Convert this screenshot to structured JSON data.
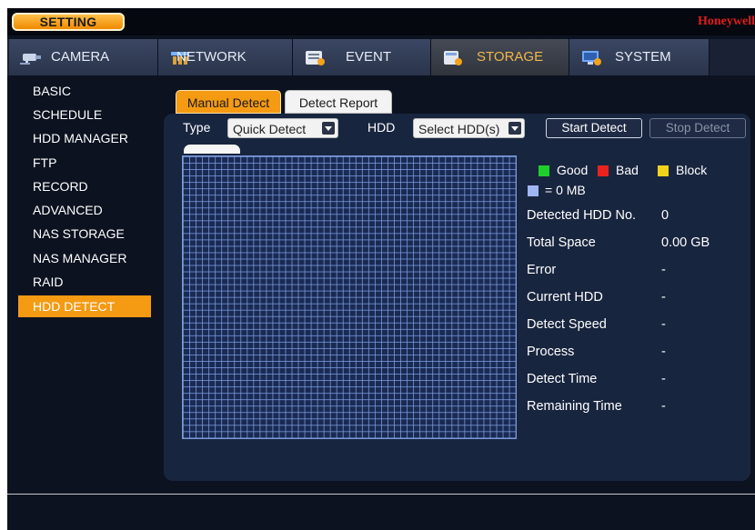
{
  "header": {
    "setting_label": "SETTING",
    "brand": "Honeywell"
  },
  "nav": [
    {
      "label": "CAMERA",
      "icon": "camera-icon",
      "active": false
    },
    {
      "label": "NETWORK",
      "icon": "network-icon",
      "active": false
    },
    {
      "label": "EVENT",
      "icon": "event-icon",
      "active": false
    },
    {
      "label": "STORAGE",
      "icon": "storage-icon",
      "active": true
    },
    {
      "label": "SYSTEM",
      "icon": "system-icon",
      "active": false
    }
  ],
  "sidebar": [
    {
      "label": "BASIC"
    },
    {
      "label": "SCHEDULE"
    },
    {
      "label": "HDD MANAGER"
    },
    {
      "label": "FTP"
    },
    {
      "label": "RECORD"
    },
    {
      "label": "ADVANCED"
    },
    {
      "label": "NAS STORAGE"
    },
    {
      "label": "NAS MANAGER"
    },
    {
      "label": "RAID"
    },
    {
      "label": "HDD DETECT",
      "active": true
    }
  ],
  "subtabs": {
    "manual": "Manual Detect",
    "report": "Detect Report"
  },
  "controls": {
    "type_label": "Type",
    "type_value": "Quick Detect",
    "hdd_label": "HDD",
    "hdd_value": "Select HDD(s)",
    "start_label": "Start Detect",
    "stop_label": "Stop Detect"
  },
  "legend": {
    "good": "Good",
    "bad": "Bad",
    "block": "Block",
    "unit": "= 0 MB"
  },
  "colors": {
    "accent": "#f49a13",
    "good": "#1ecf2a",
    "bad": "#e8231f",
    "block": "#f1d21a",
    "unit": "#9fb6f5"
  },
  "info": [
    {
      "key": "Detected HDD No.",
      "value": "0"
    },
    {
      "key": "Total Space",
      "value": "0.00 GB"
    },
    {
      "key": "Error",
      "value": "-"
    },
    {
      "key": "Current HDD",
      "value": "-"
    },
    {
      "key": "Detect Speed",
      "value": "-"
    },
    {
      "key": "Process",
      "value": "-"
    },
    {
      "key": "Detect Time",
      "value": "-"
    },
    {
      "key": "Remaining Time",
      "value": "-"
    }
  ]
}
